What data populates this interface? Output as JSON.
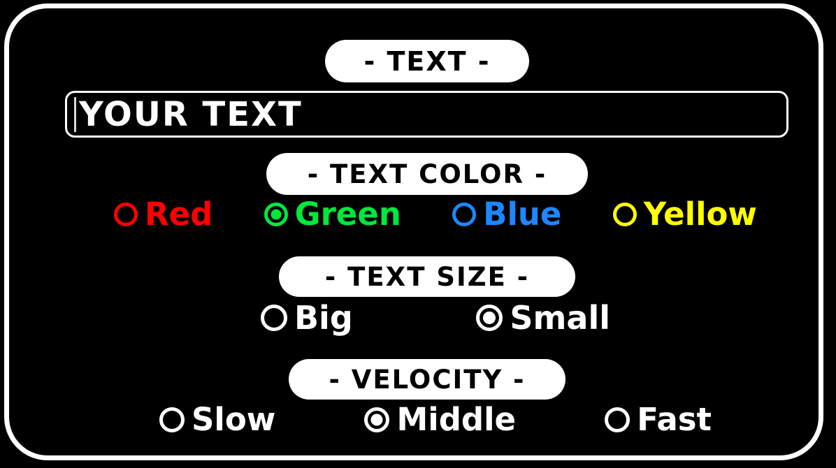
{
  "app": {
    "background_color": "#000000",
    "frame_color": "#ffffff"
  },
  "sections": {
    "text": {
      "header": "- TEXT -",
      "input": {
        "value": "YOUR TEXT",
        "placeholder": "YOUR TEXT",
        "caret_visible": true,
        "text_color": "#ffffff"
      }
    },
    "text_color": {
      "header": "- TEXT COLOR -",
      "selected": "Green",
      "options": [
        {
          "label": "Red",
          "color": "#ff0000",
          "selected": false
        },
        {
          "label": "Green",
          "color": "#00e83c",
          "selected": true
        },
        {
          "label": "Blue",
          "color": "#1e86ff",
          "selected": false
        },
        {
          "label": "Yellow",
          "color": "#ffff00",
          "selected": false
        }
      ]
    },
    "text_size": {
      "header": "- TEXT SIZE -",
      "selected": "Small",
      "options": [
        {
          "label": "Big",
          "color": "#ffffff",
          "selected": false
        },
        {
          "label": "Small",
          "color": "#ffffff",
          "selected": true
        }
      ]
    },
    "velocity": {
      "header": "- VELOCITY -",
      "selected": "Middle",
      "options": [
        {
          "label": "Slow",
          "color": "#ffffff",
          "selected": false
        },
        {
          "label": "Middle",
          "color": "#ffffff",
          "selected": true
        },
        {
          "label": "Fast",
          "color": "#ffffff",
          "selected": false
        }
      ]
    }
  }
}
